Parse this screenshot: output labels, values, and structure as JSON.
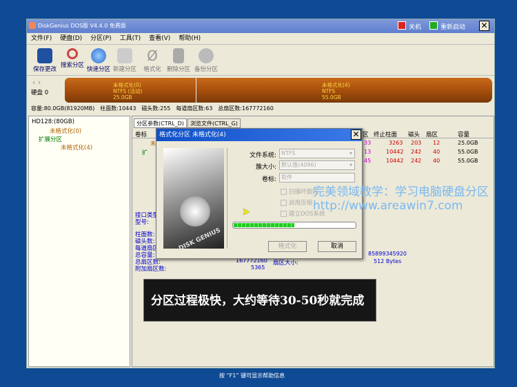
{
  "window": {
    "title": "DiskGenius DOS版 V4.4.0 免费版",
    "shutdown": "关机",
    "restart": "重新启动"
  },
  "menu": [
    "文件(F)",
    "硬盘(D)",
    "分区(P)",
    "工具(T)",
    "查看(V)",
    "帮助(H)"
  ],
  "toolbar": [
    {
      "label": "保存更改",
      "icon": "save-icon",
      "enabled": true
    },
    {
      "label": "搜索分区",
      "icon": "search-icon",
      "enabled": true
    },
    {
      "label": "快速分区",
      "icon": "quick-partition-icon",
      "enabled": true
    },
    {
      "label": "新建分区",
      "icon": "new-partition-icon",
      "enabled": false
    },
    {
      "label": "格式化",
      "icon": "format-icon",
      "enabled": false
    },
    {
      "label": "删除分区",
      "icon": "trash-icon",
      "enabled": false
    },
    {
      "label": "备份分区",
      "icon": "backup-icon",
      "enabled": false
    }
  ],
  "disk": {
    "label": "硬盘 0",
    "partitions": [
      {
        "name": "未格式化(0)",
        "fs": "NTFS (活动)",
        "size": "25.0GB"
      },
      {
        "name": "未格式化(4)",
        "fs": "NTFS",
        "size": "55.0GB"
      }
    ]
  },
  "info": [
    "容量:80.0GB(81920MB)",
    "柱面数:10443",
    "磁头数:255",
    "每道扇区数:63",
    "总扇区数:167772160"
  ],
  "tree": [
    "HD128:(80GB)",
    "未格式化(0)",
    "扩展分区",
    "未格式化(4)"
  ],
  "tabs": [
    "分区参数(CTRL_D)",
    "浏览文件(CTRL_G)"
  ],
  "table": {
    "headers": [
      "卷标",
      "区",
      "终止柱面",
      "磁头",
      "扇区",
      "容量"
    ],
    "rows": [
      [
        "未",
        "33",
        "3263",
        "203",
        "12",
        "25.0GB"
      ],
      [
        "扩",
        "13",
        "10442",
        "242",
        "40",
        "55.0GB"
      ],
      [
        "",
        "45",
        "10442",
        "242",
        "40",
        "55.0GB"
      ]
    ]
  },
  "details": {
    "labels": [
      "接口类型",
      "型号:",
      "柱面数:",
      "磁头数:",
      "每道扇区",
      "总容量:",
      "总扇区数:",
      "附加扇区数:"
    ],
    "total_sectors": "167772160",
    "extra_sectors": "5365",
    "sector_size_label": "扇区大小:",
    "sector_size": "512 Bytes",
    "total_bytes": "85899345920"
  },
  "dialog": {
    "title": "格式化分区 未格式化(4)",
    "fs_label": "文件系统:",
    "fs_value": "NTFS",
    "cluster_label": "簇大小:",
    "cluster_value": "默认值(4096)",
    "volume_label": "卷标:",
    "volume_value": "软件",
    "chk_scan": "扫描坏扇区",
    "chk_compress": "启用压缩",
    "chk_dos": "建立DOS系统",
    "progress": 0.5,
    "format_btn": "格式化",
    "cancel_btn": "取消",
    "image_text": "DISK GENIUS"
  },
  "banner": "分区过程极快，大约等待30-50秒就完成",
  "watermark": {
    "line1": "完美领域教学：学习电脑硬盘分区",
    "line2": "http://www.areawin7.com"
  },
  "status": "按 “F1” 键可显示帮助信息"
}
